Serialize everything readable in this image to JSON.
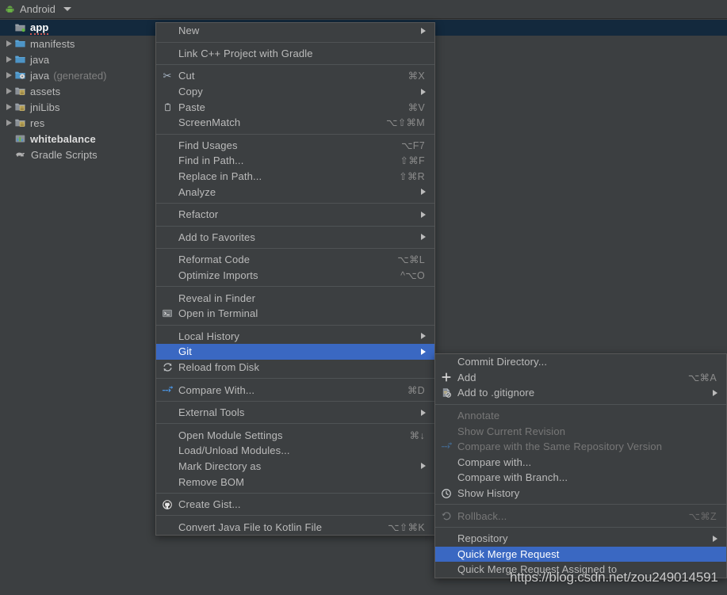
{
  "toolbar": {
    "label": "Android",
    "icon": "android-robot-icon",
    "caret": "chevron-down-icon"
  },
  "project_tree": {
    "items": [
      {
        "label": "app",
        "icon": "module-folder-icon",
        "expandable": false,
        "selected": true,
        "bold": true,
        "suffix": ""
      },
      {
        "label": "manifests",
        "icon": "folder-blue-icon",
        "expandable": true,
        "selected": false,
        "bold": false,
        "suffix": ""
      },
      {
        "label": "java",
        "icon": "folder-blue-icon",
        "expandable": true,
        "selected": false,
        "bold": false,
        "suffix": ""
      },
      {
        "label": "java",
        "icon": "folder-generated-icon",
        "expandable": true,
        "selected": false,
        "bold": false,
        "suffix": "(generated)"
      },
      {
        "label": "assets",
        "icon": "folder-resource-icon",
        "expandable": true,
        "selected": false,
        "bold": false,
        "suffix": ""
      },
      {
        "label": "jniLibs",
        "icon": "folder-resource-icon",
        "expandable": true,
        "selected": false,
        "bold": false,
        "suffix": ""
      },
      {
        "label": "res",
        "icon": "folder-resource-icon",
        "expandable": true,
        "selected": false,
        "bold": false,
        "suffix": ""
      },
      {
        "label": "whitebalance",
        "icon": "library-module-icon",
        "expandable": false,
        "selected": false,
        "bold": true,
        "suffix": ""
      },
      {
        "label": "Gradle Scripts",
        "icon": "gradle-elephant-icon",
        "expandable": false,
        "selected": false,
        "bold": false,
        "suffix": ""
      }
    ]
  },
  "context_menu": {
    "groups": [
      {
        "items": [
          {
            "label": "New",
            "accel": "",
            "icon": "",
            "submenu": true,
            "selected": false,
            "disabled": false
          }
        ]
      },
      {
        "items": [
          {
            "label": "Link C++ Project with Gradle",
            "accel": "",
            "icon": "",
            "submenu": false,
            "selected": false,
            "disabled": false
          }
        ]
      },
      {
        "items": [
          {
            "label": "Cut",
            "accel": "⌘X",
            "icon": "scissors-icon",
            "submenu": false,
            "selected": false,
            "disabled": false
          },
          {
            "label": "Copy",
            "accel": "",
            "icon": "",
            "submenu": true,
            "selected": false,
            "disabled": false
          },
          {
            "label": "Paste",
            "accel": "⌘V",
            "icon": "clipboard-icon",
            "submenu": false,
            "selected": false,
            "disabled": false
          },
          {
            "label": "ScreenMatch",
            "accel": "⌥⇧⌘M",
            "icon": "",
            "submenu": false,
            "selected": false,
            "disabled": false
          }
        ]
      },
      {
        "items": [
          {
            "label": "Find Usages",
            "accel": "⌥F7",
            "icon": "",
            "submenu": false,
            "selected": false,
            "disabled": false
          },
          {
            "label": "Find in Path...",
            "accel": "⇧⌘F",
            "icon": "",
            "submenu": false,
            "selected": false,
            "disabled": false
          },
          {
            "label": "Replace in Path...",
            "accel": "⇧⌘R",
            "icon": "",
            "submenu": false,
            "selected": false,
            "disabled": false
          },
          {
            "label": "Analyze",
            "accel": "",
            "icon": "",
            "submenu": true,
            "selected": false,
            "disabled": false
          }
        ]
      },
      {
        "items": [
          {
            "label": "Refactor",
            "accel": "",
            "icon": "",
            "submenu": true,
            "selected": false,
            "disabled": false
          }
        ]
      },
      {
        "items": [
          {
            "label": "Add to Favorites",
            "accel": "",
            "icon": "",
            "submenu": true,
            "selected": false,
            "disabled": false
          }
        ]
      },
      {
        "items": [
          {
            "label": "Reformat Code",
            "accel": "⌥⌘L",
            "icon": "",
            "submenu": false,
            "selected": false,
            "disabled": false
          },
          {
            "label": "Optimize Imports",
            "accel": "^⌥O",
            "icon": "",
            "submenu": false,
            "selected": false,
            "disabled": false
          }
        ]
      },
      {
        "items": [
          {
            "label": "Reveal in Finder",
            "accel": "",
            "icon": "",
            "submenu": false,
            "selected": false,
            "disabled": false
          },
          {
            "label": "Open in Terminal",
            "accel": "",
            "icon": "terminal-icon",
            "submenu": false,
            "selected": false,
            "disabled": false
          }
        ]
      },
      {
        "items": [
          {
            "label": "Local History",
            "accel": "",
            "icon": "",
            "submenu": true,
            "selected": false,
            "disabled": false
          },
          {
            "label": "Git",
            "accel": "",
            "icon": "",
            "submenu": true,
            "selected": true,
            "disabled": false
          },
          {
            "label": "Reload from Disk",
            "accel": "",
            "icon": "refresh-icon",
            "submenu": false,
            "selected": false,
            "disabled": false
          }
        ]
      },
      {
        "items": [
          {
            "label": "Compare With...",
            "accel": "⌘D",
            "icon": "compare-icon",
            "submenu": false,
            "selected": false,
            "disabled": false
          }
        ]
      },
      {
        "items": [
          {
            "label": "External Tools",
            "accel": "",
            "icon": "",
            "submenu": true,
            "selected": false,
            "disabled": false
          }
        ]
      },
      {
        "items": [
          {
            "label": "Open Module Settings",
            "accel": "⌘↓",
            "icon": "",
            "submenu": false,
            "selected": false,
            "disabled": false
          },
          {
            "label": "Load/Unload Modules...",
            "accel": "",
            "icon": "",
            "submenu": false,
            "selected": false,
            "disabled": false
          },
          {
            "label": "Mark Directory as",
            "accel": "",
            "icon": "",
            "submenu": true,
            "selected": false,
            "disabled": false
          },
          {
            "label": "Remove BOM",
            "accel": "",
            "icon": "",
            "submenu": false,
            "selected": false,
            "disabled": false
          }
        ]
      },
      {
        "items": [
          {
            "label": "Create Gist...",
            "accel": "",
            "icon": "github-icon",
            "submenu": false,
            "selected": false,
            "disabled": false
          }
        ]
      },
      {
        "items": [
          {
            "label": "Convert Java File to Kotlin File",
            "accel": "⌥⇧⌘K",
            "icon": "",
            "submenu": false,
            "selected": false,
            "disabled": false
          }
        ]
      }
    ]
  },
  "git_submenu": {
    "groups": [
      {
        "items": [
          {
            "label": "Commit Directory...",
            "accel": "",
            "icon": "",
            "submenu": false,
            "selected": false,
            "disabled": false
          },
          {
            "label": "Add",
            "accel": "⌥⌘A",
            "icon": "plus-icon",
            "submenu": false,
            "selected": false,
            "disabled": false
          },
          {
            "label": "Add to .gitignore",
            "accel": "",
            "icon": "gitignore-icon",
            "submenu": true,
            "selected": false,
            "disabled": false
          }
        ]
      },
      {
        "items": [
          {
            "label": "Annotate",
            "accel": "",
            "icon": "",
            "submenu": false,
            "selected": false,
            "disabled": true
          },
          {
            "label": "Show Current Revision",
            "accel": "",
            "icon": "",
            "submenu": false,
            "selected": false,
            "disabled": true
          },
          {
            "label": "Compare with the Same Repository Version",
            "accel": "",
            "icon": "compare-icon",
            "submenu": false,
            "selected": false,
            "disabled": true
          },
          {
            "label": "Compare with...",
            "accel": "",
            "icon": "",
            "submenu": false,
            "selected": false,
            "disabled": false
          },
          {
            "label": "Compare with Branch...",
            "accel": "",
            "icon": "",
            "submenu": false,
            "selected": false,
            "disabled": false
          },
          {
            "label": "Show History",
            "accel": "",
            "icon": "clock-icon",
            "submenu": false,
            "selected": false,
            "disabled": false
          }
        ]
      },
      {
        "items": [
          {
            "label": "Rollback...",
            "accel": "⌥⌘Z",
            "icon": "rollback-icon",
            "submenu": false,
            "selected": false,
            "disabled": true
          }
        ]
      },
      {
        "items": [
          {
            "label": "Repository",
            "accel": "",
            "icon": "",
            "submenu": true,
            "selected": false,
            "disabled": false
          },
          {
            "label": "Quick Merge Request",
            "accel": "",
            "icon": "",
            "submenu": false,
            "selected": true,
            "disabled": false
          },
          {
            "label": "Quick Merge Request Assigned to",
            "accel": "",
            "icon": "",
            "submenu": false,
            "selected": false,
            "disabled": false
          }
        ]
      }
    ]
  },
  "watermark": {
    "text": "https://blog.csdn.net/zou249014591"
  },
  "colors": {
    "panel_bg": "#3c3f41",
    "selection_blue": "#3a68c2",
    "tree_selection": "#13293d",
    "text": "#bbbbbb",
    "disabled_text": "#777777",
    "separator": "#4f5355"
  }
}
